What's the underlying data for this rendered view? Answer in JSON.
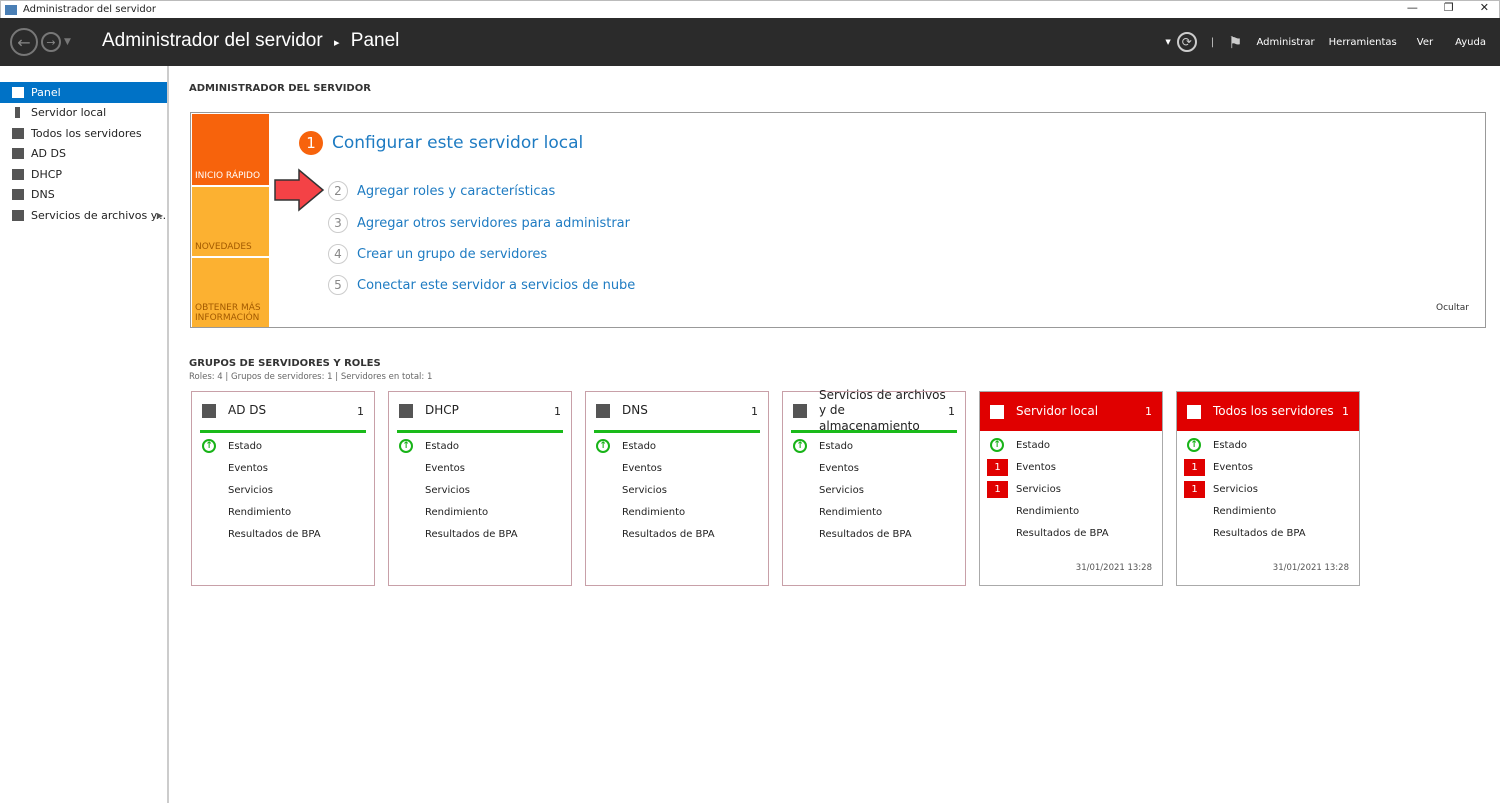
{
  "window": {
    "title": "Administrador del servidor",
    "minimize": "—",
    "restore": "❐",
    "close": "✕"
  },
  "header": {
    "app": "Administrador del servidor",
    "separator": "▸",
    "page": "Panel",
    "menu": [
      "Administrar",
      "Herramientas",
      "Ver",
      "Ayuda"
    ]
  },
  "sidebar": {
    "items": [
      {
        "label": "Panel"
      },
      {
        "label": "Servidor local"
      },
      {
        "label": "Todos los servidores"
      },
      {
        "label": "AD DS"
      },
      {
        "label": "DHCP"
      },
      {
        "label": "DNS"
      },
      {
        "label": "Servicios de archivos y..."
      }
    ]
  },
  "main": {
    "title": "ADMINISTRADOR DEL SERVIDOR",
    "quickstart": {
      "tiles": [
        "INICIO RÁPIDO",
        "NOVEDADES",
        "OBTENER MÁS INFORMACIÓN"
      ],
      "step1": {
        "n": "1",
        "label": "Configurar este servidor local"
      },
      "steps": [
        {
          "n": "2",
          "label": "Agregar roles y características"
        },
        {
          "n": "3",
          "label": "Agregar otros servidores para administrar"
        },
        {
          "n": "4",
          "label": "Crear un grupo de servidores"
        },
        {
          "n": "5",
          "label": "Conectar este servidor a servicios de nube"
        }
      ],
      "hide": "Ocultar"
    },
    "groups": {
      "title": "GRUPOS DE SERVIDORES Y ROLES",
      "summary": "Roles: 4  |  Grupos de servidores: 1  |  Servidores en total: 1",
      "cards": [
        {
          "name": "AD DS",
          "count": "1",
          "status": "ok",
          "rows": [
            "Estado",
            "Eventos",
            "Servicios",
            "Rendimiento",
            "Resultados de BPA"
          ],
          "badges": [
            "",
            "",
            "",
            "",
            ""
          ],
          "timestamp": ""
        },
        {
          "name": "DHCP",
          "count": "1",
          "status": "ok",
          "rows": [
            "Estado",
            "Eventos",
            "Servicios",
            "Rendimiento",
            "Resultados de BPA"
          ],
          "badges": [
            "",
            "",
            "",
            "",
            ""
          ],
          "timestamp": ""
        },
        {
          "name": "DNS",
          "count": "1",
          "status": "ok",
          "rows": [
            "Estado",
            "Eventos",
            "Servicios",
            "Rendimiento",
            "Resultados de BPA"
          ],
          "badges": [
            "",
            "",
            "",
            "",
            ""
          ],
          "timestamp": ""
        },
        {
          "name": "Servicios de archivos y de almacenamiento",
          "count": "1",
          "status": "ok",
          "rows": [
            "Estado",
            "Eventos",
            "Servicios",
            "Rendimiento",
            "Resultados de BPA"
          ],
          "badges": [
            "",
            "",
            "",
            "",
            ""
          ],
          "timestamp": ""
        },
        {
          "name": "Servidor local",
          "count": "1",
          "status": "bad",
          "rows": [
            "Estado",
            "Eventos",
            "Servicios",
            "Rendimiento",
            "Resultados de BPA"
          ],
          "badges": [
            "",
            "1",
            "1",
            "",
            ""
          ],
          "timestamp": "31/01/2021 13:28"
        },
        {
          "name": "Todos los servidores",
          "count": "1",
          "status": "bad",
          "rows": [
            "Estado",
            "Eventos",
            "Servicios",
            "Rendimiento",
            "Resultados de BPA"
          ],
          "badges": [
            "",
            "1",
            "1",
            "",
            ""
          ],
          "timestamp": "31/01/2021 13:28"
        }
      ]
    }
  },
  "colors": {
    "accent": "#0072c6",
    "orange": "#f7630c",
    "yellow": "#fcb131",
    "alert": "#e00000",
    "ok": "#1aba1a"
  }
}
